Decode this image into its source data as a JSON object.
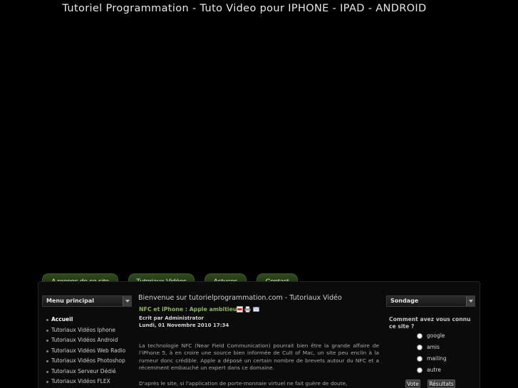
{
  "site": {
    "title": "Tutoriel Programmation - Tuto Video pour IPHONE - IPAD - ANDROID"
  },
  "topnav": [
    {
      "label": "A propos de ce site"
    },
    {
      "label": "Tutoriaux Vidéos"
    },
    {
      "label": "Astuces"
    },
    {
      "label": "Contact"
    }
  ],
  "menu": {
    "title": "Menu principal",
    "items": [
      {
        "label": "Accueil"
      },
      {
        "label": "Tutoriaux Vidéos Iphone"
      },
      {
        "label": "Tutoriaux Vidéos Android"
      },
      {
        "label": "Tutoriaux Vidéos Web Radio"
      },
      {
        "label": "Tutoriaux Vidéos Photoshop"
      },
      {
        "label": "Tutoriaux Serveur Dédié"
      },
      {
        "label": "Tutoriaux Vidéos FLEX"
      }
    ]
  },
  "main": {
    "welcome": "Bienvenue sur tutorielprogrammation.com - Tutoriaux Vidéo",
    "article": {
      "title": "NFC et iPhone : Apple ambitieux",
      "author": "Ecrit par Administrator",
      "date": "Lundi, 01 Novembre 2010 17:34",
      "paragraph1": "La technologie NFC (Near Field Communication) pourrait bien être la grande affaire de l'iPhone 5, à en croire une source bien informée de Cult of Mac, un site peu enclin à la rumeur donc crédible. Apple a déposé un certain nombre de brevets autour du NFC et a récemment embauché un expert dans ce domaine.",
      "paragraph2": "D'après le site, si l'application de porte-monnaie virtuel ne fait guère de doute,"
    },
    "icons": [
      "pdf-icon",
      "print-icon",
      "email-icon"
    ]
  },
  "poll": {
    "title": "Sondage",
    "question": "Comment avez vous connu ce site ?",
    "options": [
      {
        "label": "google"
      },
      {
        "label": "amis"
      },
      {
        "label": "mailing"
      },
      {
        "label": "autre"
      }
    ],
    "vote_label": "Vote",
    "results_label": "Résultats"
  }
}
